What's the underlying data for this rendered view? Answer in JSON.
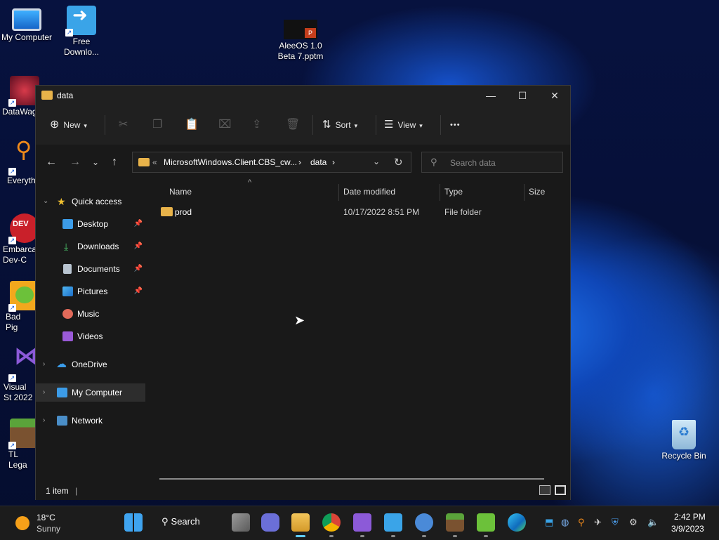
{
  "desktop": {
    "icons": [
      {
        "label": "My Computer"
      },
      {
        "label": "Free Downlo..."
      },
      {
        "label": "AleeOS 1.0 Beta 7.pptm"
      },
      {
        "label": "DataWag"
      },
      {
        "label": "Everyth"
      },
      {
        "label": "Embarca Dev-C"
      },
      {
        "label": "Bad Pig"
      },
      {
        "label": "Visual St 2022"
      },
      {
        "label": "TL Lega"
      },
      {
        "label": "Recycle Bin"
      }
    ]
  },
  "window": {
    "title": "data",
    "controls": {
      "minimize": "—",
      "maximize": "☐",
      "close": "✕"
    }
  },
  "toolbar": {
    "new_label": "New",
    "sort_label": "Sort",
    "view_label": "View",
    "more_label": "•••"
  },
  "address": {
    "prefix": "«",
    "path": [
      "MicrosoftWindows.Client.CBS_cw...",
      "data"
    ],
    "search_placeholder": "Search data"
  },
  "nav_pane": {
    "quick_access": "Quick access",
    "items": [
      {
        "label": "Desktop",
        "pinned": true
      },
      {
        "label": "Downloads",
        "pinned": true
      },
      {
        "label": "Documents",
        "pinned": true
      },
      {
        "label": "Pictures",
        "pinned": true
      },
      {
        "label": "Music",
        "pinned": false
      },
      {
        "label": "Videos",
        "pinned": false
      }
    ],
    "onedrive": "OneDrive",
    "my_computer": "My Computer",
    "network": "Network"
  },
  "columns": {
    "name": "Name",
    "date": "Date modified",
    "type": "Type",
    "size": "Size"
  },
  "files": [
    {
      "name": "prod",
      "date": "10/17/2022 8:51 PM",
      "type": "File folder",
      "size": ""
    }
  ],
  "status": {
    "count": "1 item"
  },
  "taskbar": {
    "weather_temp": "18°C",
    "weather_desc": "Sunny",
    "search_label": "Search",
    "time": "2:42 PM",
    "date": "3/9/2023"
  }
}
